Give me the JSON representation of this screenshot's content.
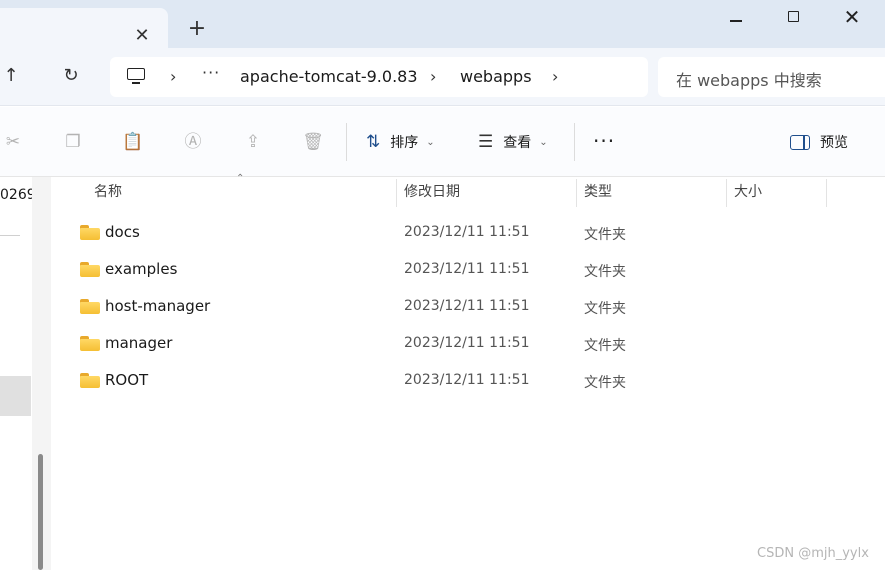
{
  "tab": {
    "close_glyph": "✕",
    "new_tab_glyph": "+"
  },
  "address": {
    "more": "···",
    "crumbs": [
      "apache-tomcat-9.0.83",
      "webapps"
    ],
    "chevron": "›"
  },
  "search": {
    "placeholder": "在 webapps 中搜索"
  },
  "toolbar": {
    "sort_label": "排序",
    "view_label": "查看",
    "more_glyph": "···",
    "preview_label": "预览",
    "icons": [
      "cut-icon",
      "copy-icon",
      "paste-icon",
      "rename-icon",
      "share-icon",
      "delete-icon"
    ]
  },
  "nav": {
    "partial_text": "0269"
  },
  "columns": {
    "name": "名称",
    "date": "修改日期",
    "type": "类型",
    "size": "大小"
  },
  "files": [
    {
      "name": "docs",
      "date": "2023/12/11 11:51",
      "type": "文件夹"
    },
    {
      "name": "examples",
      "date": "2023/12/11 11:51",
      "type": "文件夹"
    },
    {
      "name": "host-manager",
      "date": "2023/12/11 11:51",
      "type": "文件夹"
    },
    {
      "name": "manager",
      "date": "2023/12/11 11:51",
      "type": "文件夹"
    },
    {
      "name": "ROOT",
      "date": "2023/12/11 11:51",
      "type": "文件夹"
    }
  ],
  "watermark": "CSDN @mjh_yylx",
  "colors": {
    "accent": "#1f4e8c",
    "folder": "#f5bf34",
    "titlebar": "#dfe8f3"
  }
}
